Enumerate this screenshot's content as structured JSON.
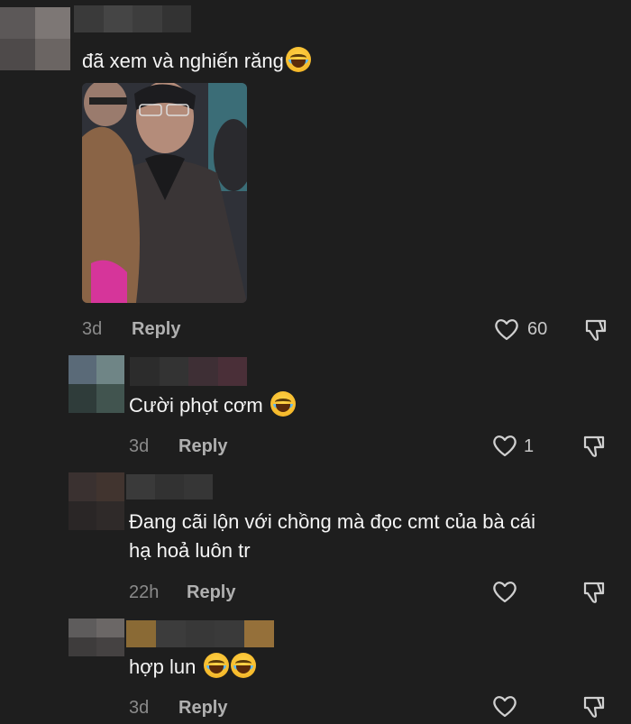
{
  "comments": [
    {
      "text": "đã xem và nghiến răng",
      "emoji_count": 1,
      "time": "3d",
      "reply_label": "Reply",
      "likes": "60",
      "has_image": true
    },
    {
      "text": "Cười phọt cơm",
      "emoji_count": 1,
      "time": "3d",
      "reply_label": "Reply",
      "likes": "1"
    },
    {
      "text_line1": "Đang cãi lộn với chồng mà đọc cmt của bà cái",
      "text_line2": "hạ hoả luôn tr",
      "time": "22h",
      "reply_label": "Reply",
      "likes": ""
    },
    {
      "text": "hợp lun",
      "emoji_count": 2,
      "time": "3d",
      "reply_label": "Reply",
      "likes": ""
    }
  ],
  "icons": {
    "like": "heart-outline-icon",
    "dislike": "thumbs-down-outline-icon",
    "emoji": "face-with-tears-of-joy"
  },
  "colors": {
    "background": "#1e1e1e",
    "text": "#f5f5f5",
    "muted": "#8a8a8a"
  }
}
